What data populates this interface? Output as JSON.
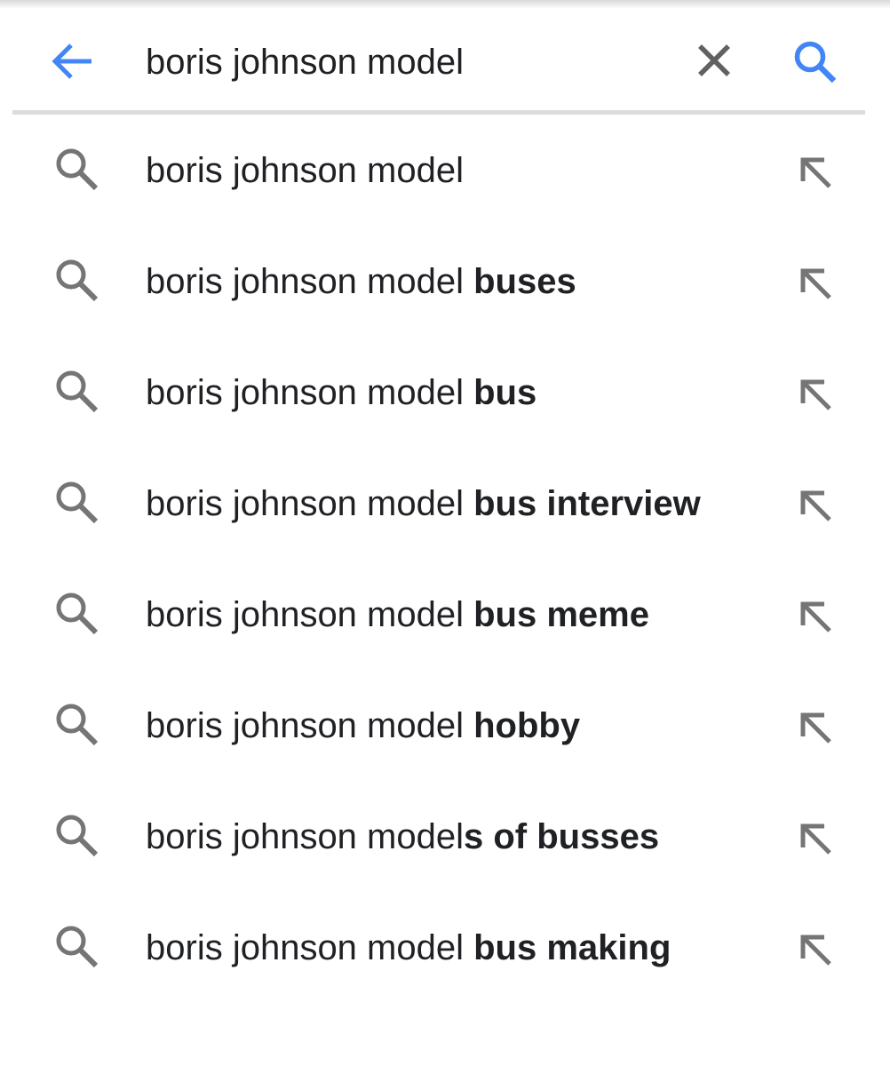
{
  "search": {
    "query": "boris johnson model",
    "icons": {
      "back": "arrow-left-icon",
      "clear": "close-icon",
      "submit": "search-icon"
    },
    "accent_color": "#4285f4"
  },
  "suggestions": [
    {
      "prefix": "boris johnson model",
      "bold": ""
    },
    {
      "prefix": "boris johnson model ",
      "bold": "buses"
    },
    {
      "prefix": "boris johnson model ",
      "bold": "bus"
    },
    {
      "prefix": "boris johnson model ",
      "bold": "bus interview"
    },
    {
      "prefix": "boris johnson model ",
      "bold": "bus meme"
    },
    {
      "prefix": "boris johnson model ",
      "bold": "hobby"
    },
    {
      "prefix": "boris johnson model",
      "bold": "s of busses"
    },
    {
      "prefix": "boris johnson model ",
      "bold": "bus making"
    }
  ],
  "suggestion_icons": {
    "leading": "search-icon",
    "trailing": "arrow-up-left-icon"
  },
  "colors": {
    "text": "#202124",
    "icon_gray": "#757575",
    "divider": "#dadce0"
  }
}
